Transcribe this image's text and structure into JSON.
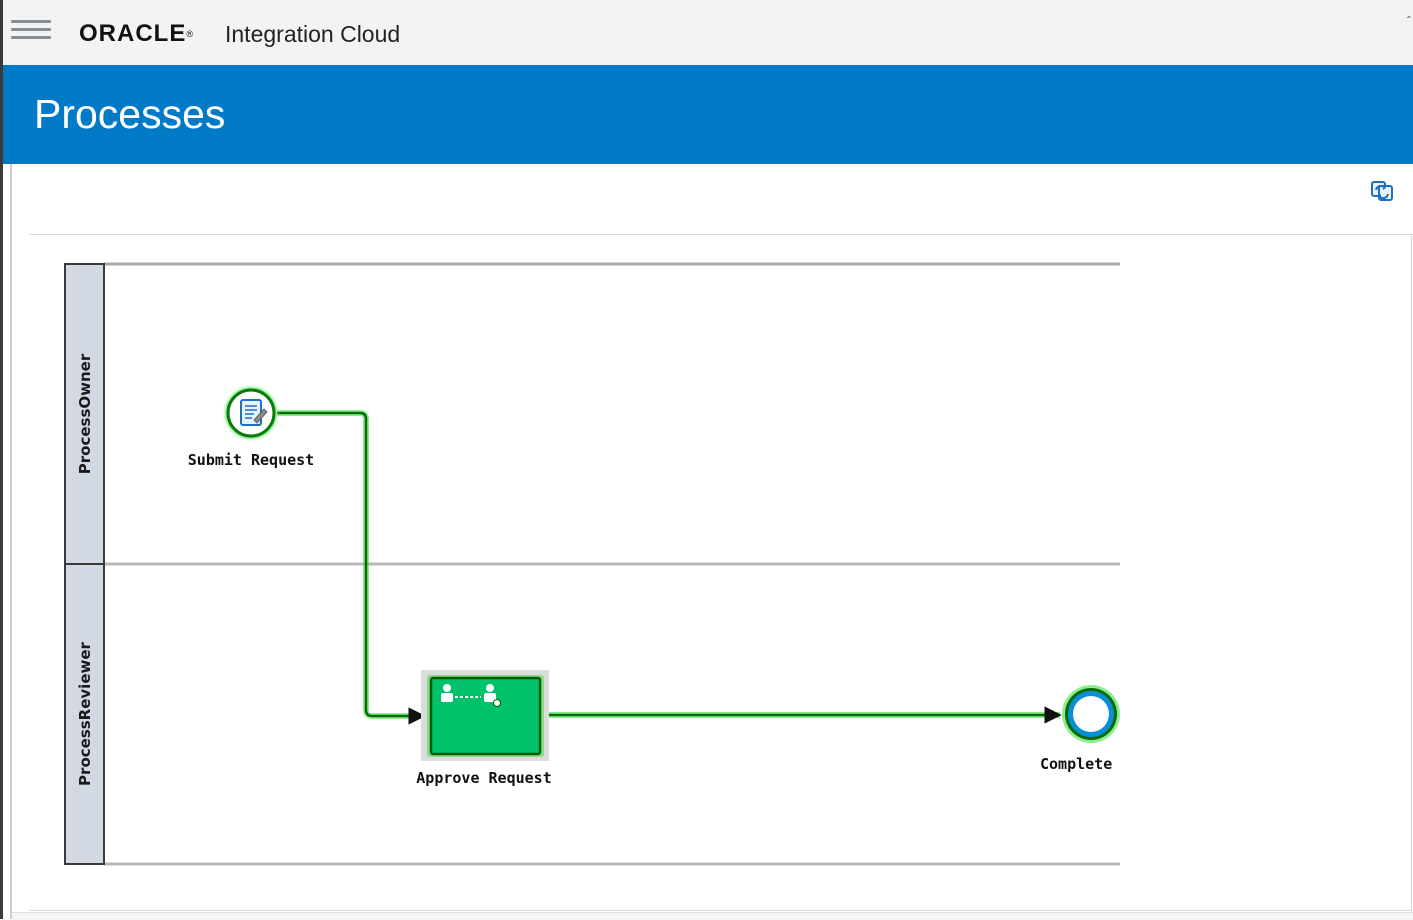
{
  "header": {
    "brand": "ORACLE",
    "brand_mark": "®",
    "product": "Integration Cloud",
    "corner_mark": "ˆ"
  },
  "banner": {
    "title": "Processes"
  },
  "toolbar": {
    "refresh_icon": "refresh-icon"
  },
  "diagram": {
    "lanes": [
      {
        "label": "ProcessOwner"
      },
      {
        "label": "ProcessReviewer"
      }
    ],
    "nodes": {
      "start": {
        "label": "Submit Request",
        "type": "start-event",
        "icon": "form-icon"
      },
      "task": {
        "label": "Approve Request",
        "type": "user-task",
        "icon": "approval-icon"
      },
      "end": {
        "label": "Complete",
        "type": "end-event"
      }
    },
    "colors": {
      "flow": "#0a8a0a",
      "flow_glow": "#2ee02e",
      "task_fill": "#00c26b",
      "end_ring": "#0a8fd6",
      "lane_header": "#d3d9e3"
    }
  }
}
